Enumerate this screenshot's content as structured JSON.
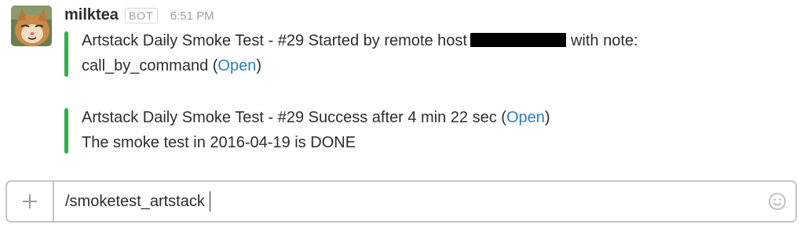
{
  "message": {
    "sender": "milktea",
    "badge": "BOT",
    "time": "6:51 PM",
    "attachments": [
      {
        "line1_before": "Artstack Daily Smoke Test - #29 Started by remote host",
        "line1_after": "with note:",
        "line2_text": "call_by_command (",
        "line2_link": "Open",
        "line2_close": ")",
        "accent_color": "#2fb14c"
      },
      {
        "line1_text": "Artstack Daily Smoke Test - #29 Success after 4 min 22 sec (",
        "line1_link": "Open",
        "line1_close": ")",
        "line2_text": "The smoke test in 2016-04-19 is DONE",
        "accent_color": "#2fb14c"
      }
    ]
  },
  "composer": {
    "plus_icon": "plus-icon",
    "value": "/smoketest_artstack",
    "emoji_icon": "smiley-icon"
  },
  "colors": {
    "link": "#2a80b9",
    "accent": "#2fb14c"
  }
}
